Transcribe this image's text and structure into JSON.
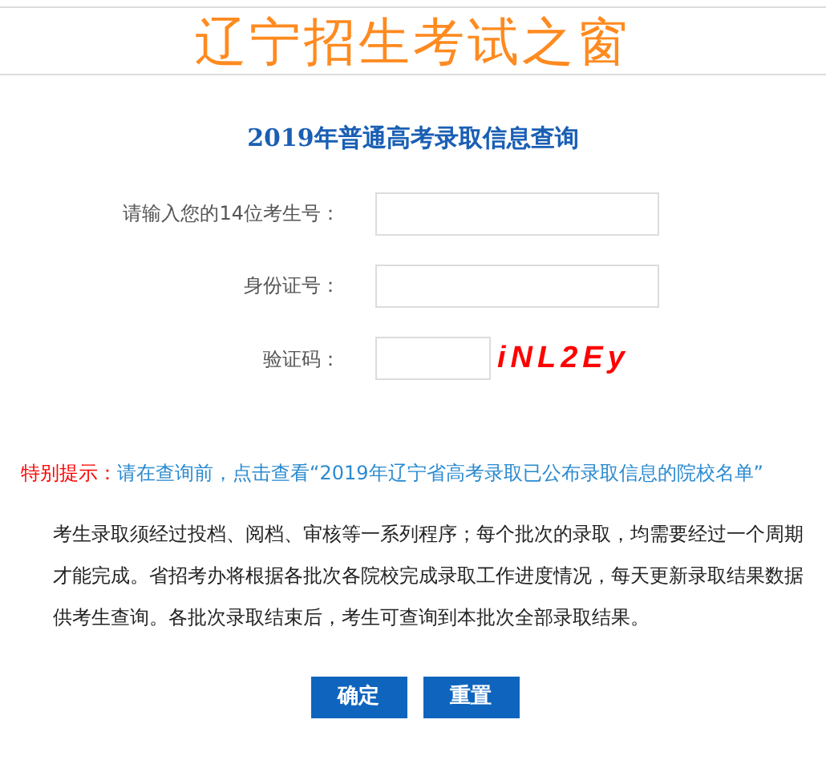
{
  "site_title": "辽宁招生考试之窗",
  "heading": "2019年普通高考录取信息查询",
  "fields": [
    {
      "kind": "text",
      "label": "请输入您的14位考生号："
    },
    {
      "kind": "text",
      "label": "身份证号："
    },
    {
      "kind": "captcha",
      "label": "验证码：",
      "code": "iNL2Ey"
    }
  ],
  "notice": {
    "label": "特别提示：",
    "link": "请在查询前，点击查看“2019年辽宁省高考录取已公布录取信息的院校名单”"
  },
  "paragraph": "考生录取须经过投档、阅档、审核等一系列程序；每个批次的录取，均需要经过一个周期才能完成。省招考办将根据各批次各院校完成录取工作进度情况，每天更新录取结果数据供考生查询。各批次录取结束后，考生可查询到本批次全部录取结果。",
  "buttons": [
    "确定",
    "重置"
  ]
}
